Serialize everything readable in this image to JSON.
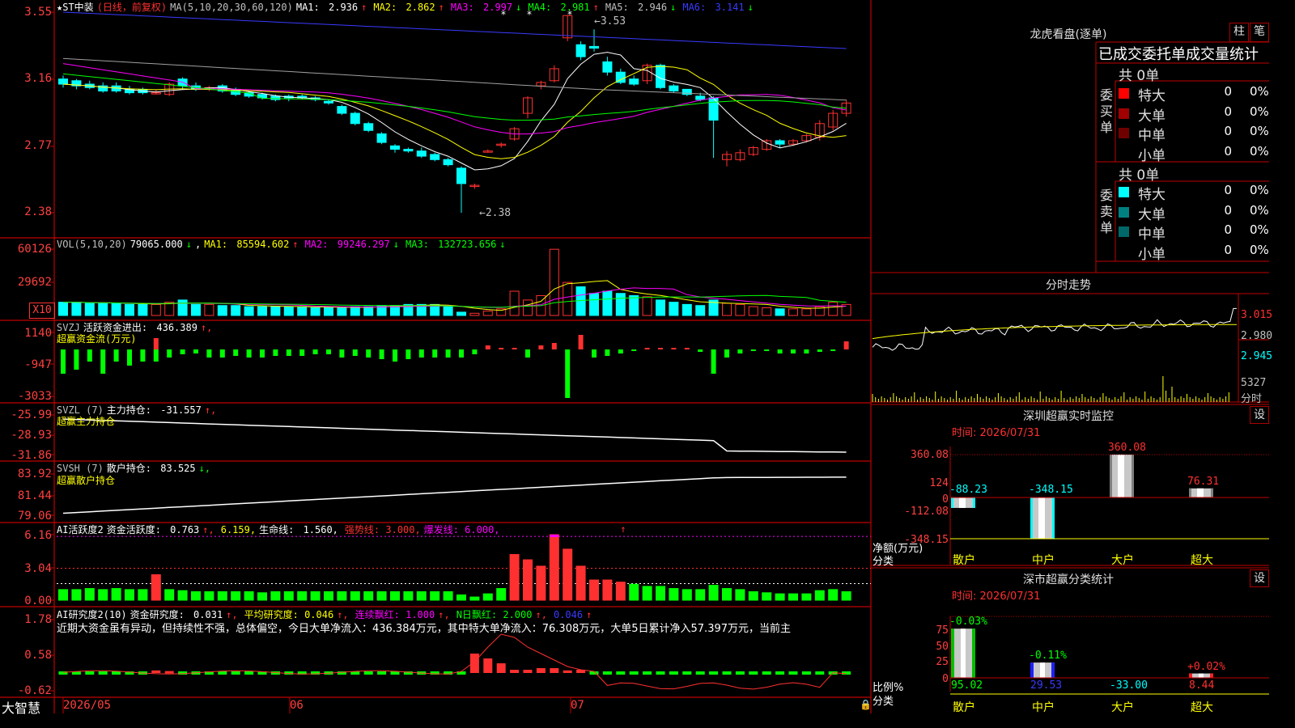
{
  "colors": {
    "up": "#ff3030",
    "down": "#00ffff",
    "grid": "#c00000",
    "label": "#ff4040",
    "white": "#ffffff",
    "yellow": "#ffff00",
    "magenta": "#ff00ff",
    "green": "#00ff00",
    "blue": "#3a3aff",
    "gray": "#a0a0a0",
    "dim": "#808080"
  },
  "main": {
    "stock_name": "★ST中装",
    "period": "(日线，前复权)",
    "ma_params": "MA(5,10,20,30,60,120)",
    "ma": [
      {
        "label": "MA1:",
        "value": "2.936",
        "arrow": "↑",
        "color": "#ffffff"
      },
      {
        "label": "MA2:",
        "value": "2.862",
        "arrow": "↑",
        "color": "#ffff00"
      },
      {
        "label": "MA3:",
        "value": "2.997",
        "arrow": "↓",
        "color": "#ff00ff"
      },
      {
        "label": "MA4:",
        "value": "2.981",
        "arrow": "↑",
        "color": "#00ff00"
      },
      {
        "label": "MA5:",
        "value": "2.946",
        "arrow": "↓",
        "color": "#c0c0c0"
      },
      {
        "label": "MA6:",
        "value": "3.141",
        "arrow": "↓",
        "color": "#3a3aff"
      }
    ],
    "y_labels": [
      "3.55",
      "3.16",
      "2.77",
      "2.38"
    ],
    "high_label": "3.53",
    "low_label": "2.38",
    "x_labels": [
      "2026/05",
      "06",
      "07"
    ],
    "brand": "大智慧"
  },
  "vol": {
    "params": "VOL(5,10,20)",
    "value": "79065.000",
    "value_arrow": "↓",
    "ma": [
      {
        "label": "MA1:",
        "value": "85594.602",
        "arrow": "↑",
        "color": "#ffff00"
      },
      {
        "label": "MA2:",
        "value": "99246.297",
        "arrow": "↓",
        "color": "#ff00ff"
      },
      {
        "label": "MA3:",
        "value": "132723.656",
        "arrow": "↓",
        "color": "#00ff00"
      }
    ],
    "y_labels": [
      "60126",
      "29692"
    ],
    "unit": "X10"
  },
  "svzj": {
    "name": "SVZJ",
    "line_label": "活跃资金进出:",
    "line_value": "436.389",
    "line_arrow": "↑,",
    "sub": "超赢资金流(万元)",
    "y_labels": [
      "1140",
      "-947",
      "-3033"
    ]
  },
  "svzl": {
    "name": "SVZL (7)",
    "line_label": "主力持仓:",
    "line_value": "-31.557",
    "line_arrow": "↑,",
    "sub": "超赢主力持仓",
    "y_labels": [
      "-25.99",
      "-28.93",
      "-31.86"
    ]
  },
  "svsh": {
    "name": "SVSH (7)",
    "line_label": "散户持仓:",
    "line_value": "83.525",
    "line_arrow": "↓,",
    "sub": "超赢散户持仓",
    "y_labels": [
      "83.92",
      "81.44",
      "79.06"
    ]
  },
  "ai_active": {
    "name": "AI活跃度2",
    "f1_label": "资金活跃度:",
    "f1_value": "0.763",
    "f1_arrow": "↑,",
    "f2_value": "6.159,",
    "f3_label": "生命线:",
    "f3_value": "1.560,",
    "f4": "强势线: 3.000,",
    "f5": "爆发线: 6.000,",
    "y_labels": [
      "6.16",
      "3.04",
      "0.00"
    ]
  },
  "ai_research": {
    "name": "AI研究度2(10)",
    "f1_label": "资金研究度:",
    "f1_value": "0.031",
    "f1_arrow": "↑,",
    "f2": "平均研究度: 0.046",
    "f2_arrow": "↑,",
    "f3": "连续飘红: 1.000",
    "f3_arrow": "↑,",
    "f4": "N日飘红: 2.000",
    "f4_arrow": "↑,",
    "f5_value": "0.046",
    "f5_arrow": "↑",
    "commentary": "近期大资金虽有异动，但持续性不强，总体偏空，今日大单净流入：436.384万元，其中特大单净流入：76.308万元，大单5日累计净入57.397万元，当前主",
    "y_labels": [
      "1.78",
      "0.58",
      "-0.62"
    ]
  },
  "right": {
    "lhb_title": "龙虎看盘(逐单)",
    "btn_zhu": "柱",
    "btn_bi": "笔",
    "stat_title": "已成交委托单成交量统计",
    "buy_label": "委买单",
    "sell_label": "委卖单",
    "buy_total": "共 0单",
    "sell_total": "共 0单",
    "buy_rows": [
      {
        "name": "特大",
        "v1": "0",
        "v2": "0%",
        "color": "#ff0000"
      },
      {
        "name": "大单",
        "v1": "0",
        "v2": "0%",
        "color": "#a00000"
      },
      {
        "name": "中单",
        "v1": "0",
        "v2": "0%",
        "color": "#700000"
      },
      {
        "name": "小单",
        "v1": "0",
        "v2": "0%",
        "color": ""
      }
    ],
    "sell_rows": [
      {
        "name": "特大",
        "v1": "0",
        "v2": "0%",
        "color": "#00ffff"
      },
      {
        "name": "大单",
        "v1": "0",
        "v2": "0%",
        "color": "#008080"
      },
      {
        "name": "中单",
        "v1": "0",
        "v2": "0%",
        "color": "#006868"
      },
      {
        "name": "小单",
        "v1": "0",
        "v2": "0%",
        "color": ""
      }
    ],
    "fenshi_title": "分时走势",
    "fenshi_y": [
      "3.015",
      "2.980",
      "2.945"
    ],
    "fenshi_vol": "5327",
    "fenshi_unit": "分时",
    "sz_title": "深圳超赢实时监控",
    "set_btn": "设",
    "time_label": "时间: 2026/07/31",
    "sz_y": [
      "360.08",
      "124",
      "0",
      "-112.08",
      "-348.15"
    ],
    "sz_axis_label": "净额(万元)",
    "sz_axis_sub": "分类",
    "sz_bars": [
      {
        "name": "散户",
        "value": -88.23,
        "label": "-88.23",
        "lcolor": "#00ffff"
      },
      {
        "name": "中户",
        "value": -348.15,
        "label": "-348.15",
        "lcolor": "#00ffff"
      },
      {
        "name": "大户",
        "value": 360.08,
        "label": "360.08",
        "lcolor": "#ff3030"
      },
      {
        "name": "超大",
        "value": 76.31,
        "label": "76.31",
        "lcolor": "#ff3030"
      }
    ],
    "sc_title": "深市超赢分类统计",
    "sc_time": "时间: 2026/07/31",
    "sc_y": [
      "75",
      "50",
      "25",
      "0"
    ],
    "sc_axis_label": "比例%",
    "sc_axis_sub": "分类",
    "sc_bars": [
      {
        "name": "散户",
        "bar": 95.02,
        "bottom": "95.02",
        "top": "-0.03%",
        "color": "#00c000",
        "bcolor": "#00ff00",
        "tcolor": "#00ff00"
      },
      {
        "name": "中户",
        "bar": 29.53,
        "bottom": "29.53",
        "top": "-0.11%",
        "color": "#2020ff",
        "bcolor": "#3a3aff",
        "tcolor": "#00ff00"
      },
      {
        "name": "大户",
        "bar": 0,
        "bottom": "-33.00",
        "top": "",
        "color": "#00c0c0",
        "bcolor": "#00ffff",
        "tcolor": "#00ff00"
      },
      {
        "name": "超大",
        "bar": 8.44,
        "bottom": "8.44",
        "top": "+0.02%",
        "color": "#ff2020",
        "bcolor": "#ff3030",
        "tcolor": "#ff3030"
      }
    ]
  }
}
